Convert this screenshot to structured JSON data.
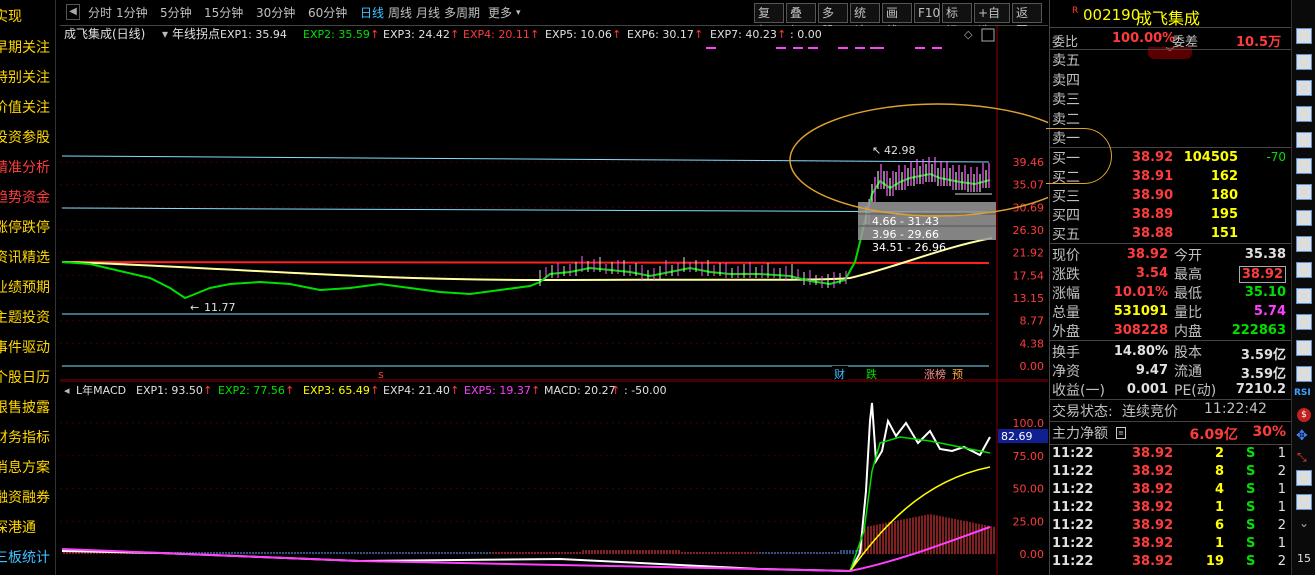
{
  "sidebar": {
    "items": [
      "实现",
      "早期关注",
      "特别关注",
      "价值关注",
      "投资参股",
      "精准分析",
      "趋势资金",
      "涨停跌停",
      "资讯精选",
      "业绩预期",
      "主题投资",
      "事件驱动",
      "个股日历",
      "限售披露",
      "财务指标",
      "消息方案",
      "融资融券",
      "深港通",
      "三板统计"
    ]
  },
  "toolbar": {
    "periods": [
      "分时",
      "1分钟",
      "5分钟",
      "15分钟",
      "30分钟",
      "60分钟",
      "日线",
      "周线",
      "月线",
      "多周期",
      "更多"
    ],
    "active": "日线",
    "more_arrow": "▾",
    "right_buttons": [
      "复权",
      "叠加",
      "多股",
      "统计",
      "画线",
      "F10",
      "标记",
      "+自选",
      "返回"
    ]
  },
  "main_chart": {
    "title": "成飞集成(日线)",
    "indicator_name": "年线拐点",
    "legend": [
      {
        "label": "EXP1: 35.94",
        "color": "#e0e0e0",
        "arrow": ""
      },
      {
        "label": "EXP2: 35.59",
        "color": "#00e000",
        "arrow": "↑"
      },
      {
        "label": "EXP3: 24.42",
        "color": "#e0e0e0",
        "arrow": "↑"
      },
      {
        "label": "EXP4: 20.11",
        "color": "#ff3c3c",
        "arrow": "↑"
      },
      {
        "label": "EXP5: 10.06",
        "color": "#e0e0e0",
        "arrow": "↑"
      },
      {
        "label": "EXP6: 30.17",
        "color": "#e0e0e0",
        "arrow": "↑"
      },
      {
        "label": "EXP7: 40.23",
        "color": "#e0e0e0",
        "arrow": "↑"
      },
      {
        "label": ": 0.00",
        "color": "#e0e0e0",
        "arrow": ""
      }
    ],
    "y_ticks": [
      "39.46",
      "35.07",
      "30.69",
      "26.30",
      "21.92",
      "17.54",
      "13.15",
      "8.77",
      "4.38",
      "0.00"
    ],
    "annotations": {
      "high": "42.98",
      "low": "11.77",
      "box1": "4.66 - 31.43",
      "box2": "3.96 - 29.66",
      "box3": "34.51 - 26.96"
    },
    "markers": {
      "s_marker": "s",
      "cai": "财",
      "die": "跌",
      "zhangbang": "涨榜",
      "yu": "预"
    }
  },
  "macd_chart": {
    "title": "L年MACD",
    "legend": [
      {
        "label": "EXP1: 93.50",
        "color": "#e0e0e0",
        "arrow": "↑"
      },
      {
        "label": "EXP2: 77.56",
        "color": "#00e000",
        "arrow": "↑"
      },
      {
        "label": "EXP3: 65.49",
        "color": "#ffff00",
        "arrow": "↑"
      },
      {
        "label": "EXP4: 21.40",
        "color": "#e0e0e0",
        "arrow": "↑"
      },
      {
        "label": "EXP5: 19.37",
        "color": "#ff40ff",
        "arrow": "↑"
      },
      {
        "label": "MACD: 20.27",
        "color": "#e0e0e0",
        "arrow": "↑"
      },
      {
        "label": ": -50.00",
        "color": "#e0e0e0",
        "arrow": ""
      }
    ],
    "y_ticks": [
      "100.0",
      "75.00",
      "50.00",
      "25.00",
      "0.00"
    ],
    "current": "82.69"
  },
  "quote": {
    "code": "002190",
    "name": "成飞集成",
    "r_mark": "R",
    "weibi_label": "委比",
    "weibi": "100.00%",
    "weicha_label": "委差",
    "weicha": "10.5万",
    "sells": [
      "卖五",
      "卖四",
      "卖三",
      "卖二",
      "卖一"
    ],
    "buys": [
      {
        "label": "买一",
        "price": "38.92",
        "vol": "104505",
        "chg": "-70"
      },
      {
        "label": "买二",
        "price": "38.91",
        "vol": "162",
        "chg": ""
      },
      {
        "label": "买三",
        "price": "38.90",
        "vol": "180",
        "chg": ""
      },
      {
        "label": "买四",
        "price": "38.89",
        "vol": "195",
        "chg": ""
      },
      {
        "label": "买五",
        "price": "38.88",
        "vol": "151",
        "chg": ""
      }
    ],
    "stats": [
      {
        "l1": "现价",
        "v1": "38.92",
        "c1": "red",
        "l2": "今开",
        "v2": "35.38",
        "c2": "white"
      },
      {
        "l1": "涨跌",
        "v1": "3.54",
        "c1": "red",
        "l2": "最高",
        "v2": "38.92",
        "c2": "red"
      },
      {
        "l1": "涨幅",
        "v1": "10.01%",
        "c1": "red",
        "l2": "最低",
        "v2": "35.10",
        "c2": "green"
      },
      {
        "l1": "总量",
        "v1": "531091",
        "c1": "yellow",
        "l2": "量比",
        "v2": "5.74",
        "c2": "mag"
      },
      {
        "l1": "外盘",
        "v1": "308228",
        "c1": "red",
        "l2": "内盘",
        "v2": "222863",
        "c2": "green"
      }
    ],
    "stats2": [
      {
        "l1": "换手",
        "v1": "14.80%",
        "l2": "股本",
        "v2": "3.59亿"
      },
      {
        "l1": "净资",
        "v1": "9.47",
        "l2": "流通",
        "v2": "3.59亿"
      },
      {
        "l1": "收益(一)",
        "v1": "0.001",
        "l2": "PE(动)",
        "v2": "7210.2"
      }
    ],
    "trade_status_label": "交易状态:",
    "trade_status": "连续竞价",
    "trade_time": "11:22:42",
    "main_net_label": "主力净额",
    "main_net": "6.09亿",
    "main_net_pct": "30%",
    "ticks": [
      {
        "t": "11:22",
        "p": "38.92",
        "v": "2",
        "s": "S",
        "n": "1"
      },
      {
        "t": "11:22",
        "p": "38.92",
        "v": "8",
        "s": "S",
        "n": "2"
      },
      {
        "t": "11:22",
        "p": "38.92",
        "v": "4",
        "s": "S",
        "n": "1"
      },
      {
        "t": "11:22",
        "p": "38.92",
        "v": "1",
        "s": "S",
        "n": "1"
      },
      {
        "t": "11:22",
        "p": "38.92",
        "v": "6",
        "s": "S",
        "n": "2"
      },
      {
        "t": "11:22",
        "p": "38.92",
        "v": "1",
        "s": "S",
        "n": "1"
      },
      {
        "t": "11:22",
        "p": "38.92",
        "v": "19",
        "s": "S",
        "n": "2"
      }
    ]
  },
  "iconbar": {
    "labels": [
      "RSI",
      "15"
    ]
  }
}
